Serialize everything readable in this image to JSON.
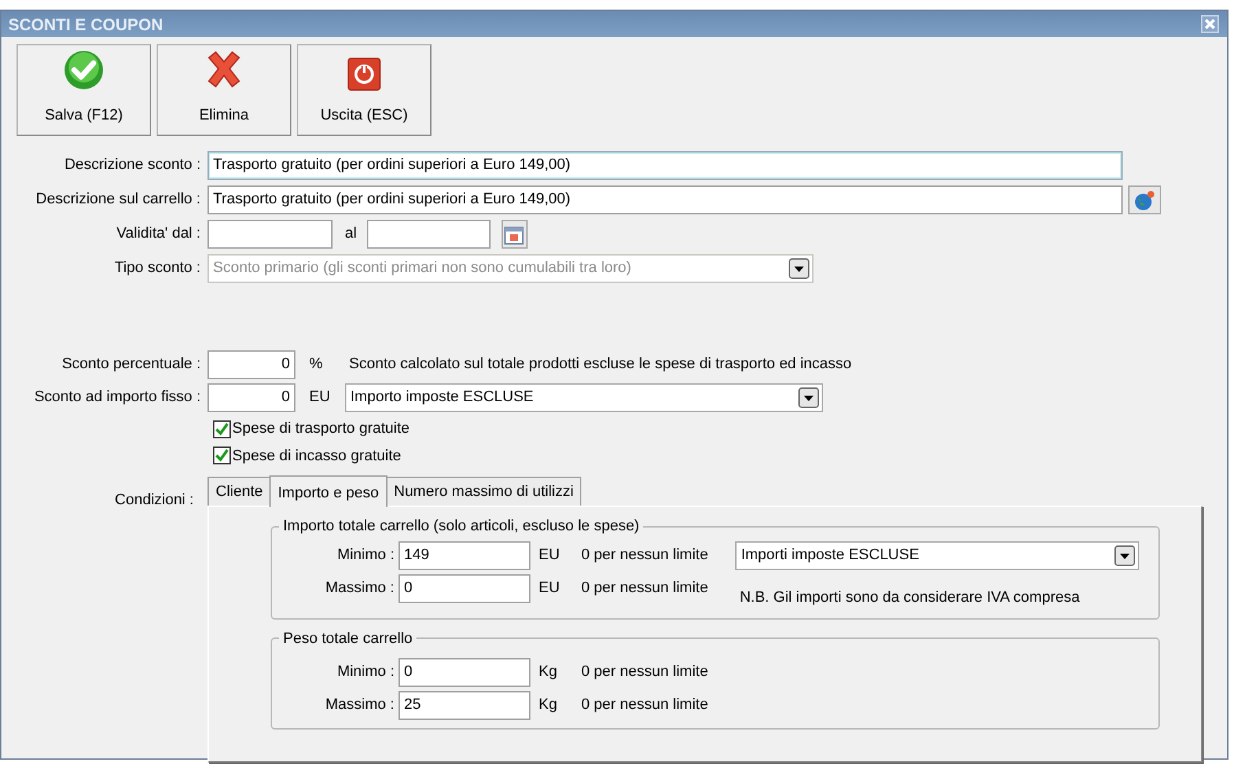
{
  "window": {
    "title": "SCONTI E COUPON"
  },
  "toolbar": [
    {
      "kind": "save",
      "label": "Salva (F12)"
    },
    {
      "kind": "delete",
      "label": "Elimina"
    },
    {
      "kind": "exit",
      "label": "Uscita (ESC)"
    }
  ],
  "descrizione_sconto": {
    "label": "Descrizione sconto :",
    "value": "Trasporto gratuito (per ordini superiori a Euro 149,00)"
  },
  "descrizione_carrello": {
    "label": "Descrizione sul carrello :",
    "value": "Trasporto gratuito (per ordini superiori a Euro 149,00)"
  },
  "validita": {
    "label": "Validita' dal :",
    "to_label": "al"
  },
  "tipo_sconto": {
    "label": "Tipo sconto :",
    "value": "Sconto primario (gli sconti primari non sono cumulabili tra loro)",
    "disabled": true
  },
  "sconto_percentuale": {
    "label": "Sconto percentuale :",
    "value": "0",
    "unit": "%",
    "note": "Sconto calcolato sul totale prodotti escluse le spese di trasporto ed incasso"
  },
  "sconto_importo": {
    "label": "Sconto ad importo fisso :",
    "value": "0",
    "unit": "EU",
    "select": "Importo imposte ESCLUSE"
  },
  "checkboxes": [
    {
      "label": "Spese di trasporto gratuite",
      "checked": true
    },
    {
      "label": "Spese di incasso gratuite",
      "checked": true
    }
  ],
  "condizioni": {
    "label": "Condizioni :",
    "tabs": [
      {
        "label": "Cliente",
        "selected": false
      },
      {
        "label": "Importo e peso",
        "selected": true
      },
      {
        "label": "Numero massimo di utilizzi",
        "selected": false
      }
    ],
    "groups": [
      {
        "title": "Importo totale carrello (solo articoli, escluso le spese)",
        "select": "Importi imposte ESCLUSE",
        "note": "N.B. Gil importi sono da considerare IVA compresa",
        "rows": [
          {
            "label": "Minimo :",
            "value": "149",
            "unit": "EU",
            "hint": "0 per nessun limite"
          },
          {
            "label": "Massimo :",
            "value": "0",
            "unit": "EU",
            "hint": "0 per nessun limite"
          }
        ]
      },
      {
        "title": "Peso totale carrello",
        "rows": [
          {
            "label": "Minimo :",
            "value": "0",
            "unit": "Kg",
            "hint": "0 per nessun limite"
          },
          {
            "label": "Massimo :",
            "value": "25",
            "unit": "Kg",
            "hint": "0 per nessun limite"
          }
        ]
      }
    ]
  }
}
